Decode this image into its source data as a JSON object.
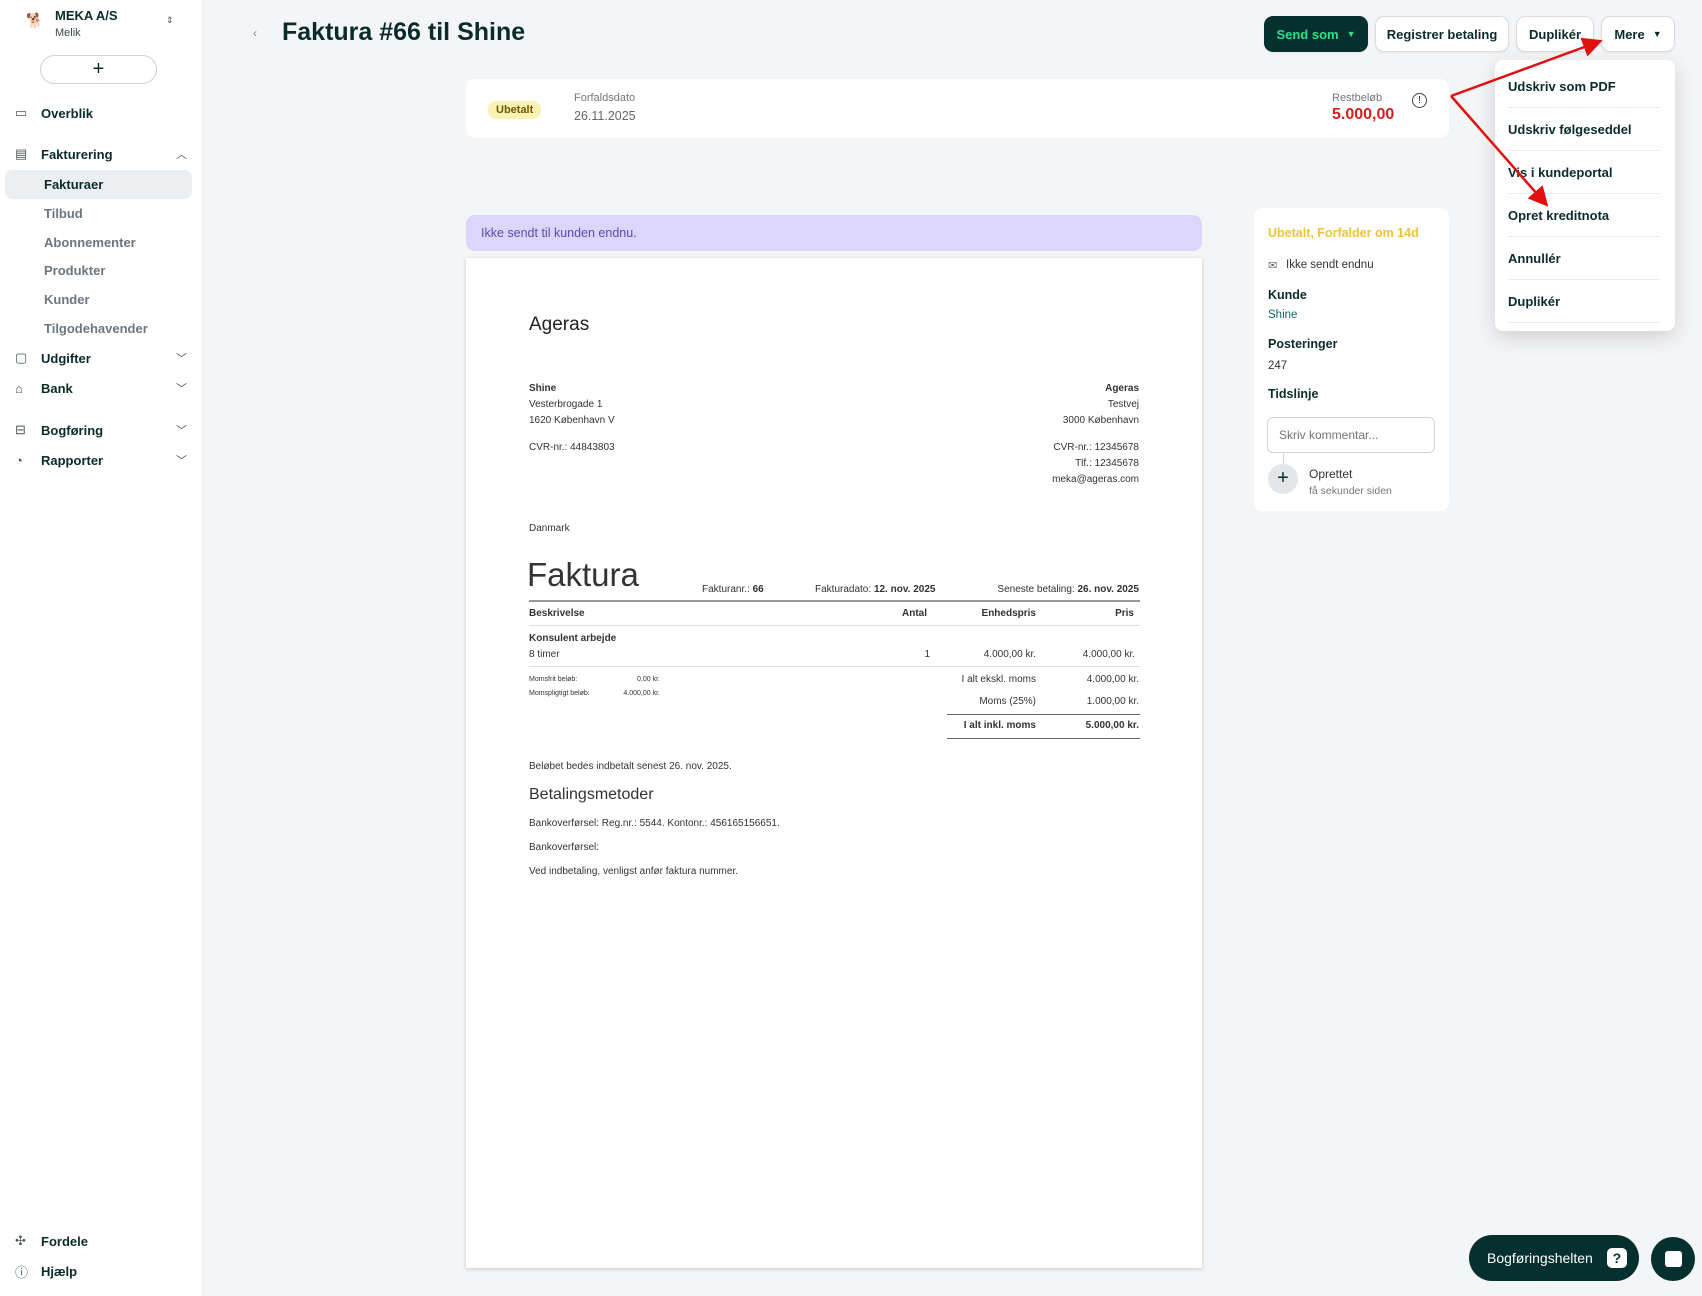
{
  "sidebar": {
    "org_name": "MEKA A/S",
    "user": "Melik",
    "add_label": "+",
    "items": [
      {
        "label": "Overblik"
      },
      {
        "label": "Fakturering"
      },
      {
        "label": "Udgifter"
      },
      {
        "label": "Bank"
      },
      {
        "label": "Bogføring"
      },
      {
        "label": "Rapporter"
      }
    ],
    "sub_items": [
      {
        "label": "Fakturaer"
      },
      {
        "label": "Tilbud"
      },
      {
        "label": "Abonnementer"
      },
      {
        "label": "Produkter"
      },
      {
        "label": "Kunder"
      },
      {
        "label": "Tilgodehavender"
      }
    ],
    "bottom": [
      {
        "label": "Fordele"
      },
      {
        "label": "Hjælp"
      }
    ]
  },
  "header": {
    "title": "Faktura #66 til Shine",
    "send_label": "Send som",
    "register_label": "Registrer betaling",
    "duplicate_label": "Duplikér",
    "more_label": "Mere"
  },
  "status": {
    "badge": "Ubetalt",
    "due_label": "Forfaldsdato",
    "due_value": "26.11.2025",
    "rest_label": "Restbeløb",
    "rest_value": "5.000,00"
  },
  "banner": "Ikke sendt til kunden endnu.",
  "menu": [
    "Udskriv som PDF",
    "Udskriv følgeseddel",
    "Vis i kundeportal",
    "Opret kreditnota",
    "Annullér",
    "Duplikér"
  ],
  "panel": {
    "status": "Ubetalt, Forfalder om 14d",
    "sent": "Ikke sendt endnu",
    "customer_label": "Kunde",
    "customer": "Shine",
    "postings_label": "Posteringer",
    "postings": "247",
    "timeline_label": "Tidslinje",
    "comment_placeholder": "Skriv kommentar...",
    "event": "Oprettet",
    "event_time": "få sekunder siden"
  },
  "doc": {
    "company": "Ageras",
    "customer": {
      "name": "Shine",
      "street": "Vesterbrogade 1",
      "city": "1620 København V",
      "cvr": "CVR-nr.: 44843803",
      "country": "Danmark"
    },
    "sender": {
      "name": "Ageras",
      "street": "Testvej",
      "city": "3000 København",
      "cvr": "CVR-nr.: 12345678",
      "phone": "Tlf.: 12345678",
      "email": "meka@ageras.com"
    },
    "heading": "Faktura",
    "number_label": "Fakturanr.:",
    "number": "66",
    "date_label": "Fakturadato:",
    "date": "12. nov. 2025",
    "due_label": "Seneste betaling:",
    "due": "26. nov. 2025",
    "columns": [
      "Beskrivelse",
      "Antal",
      "Enhedspris",
      "Pris"
    ],
    "line": {
      "title": "Konsulent arbejde",
      "desc": "8 timer",
      "qty": "1",
      "unit": "4.000,00 kr.",
      "price": "4.000,00 kr."
    },
    "vatfree_label": "Momsfrit beløb:",
    "vatfree": "0,00 kr.",
    "vatable_label": "Momspligtigt beløb:",
    "vatable": "4.000,00 kr.",
    "subtotal_label": "I alt ekskl. moms",
    "subtotal": "4.000,00 kr.",
    "vat_label": "Moms (25%)",
    "vat": "1.000,00 kr.",
    "total_label": "I alt inkl. moms",
    "total": "5.000,00 kr.",
    "pay_note": "Beløbet bedes indbetalt senest 26. nov. 2025.",
    "methods_heading": "Betalingsmetoder",
    "method1": "Bankoverførsel: Reg.nr.: 5544. Kontonr.: 456165156651.",
    "method2": "Bankoverførsel:",
    "method_note": "Ved indbetaling, venligst anfør faktura nummer."
  },
  "helper_label": "Bogføringshelten"
}
